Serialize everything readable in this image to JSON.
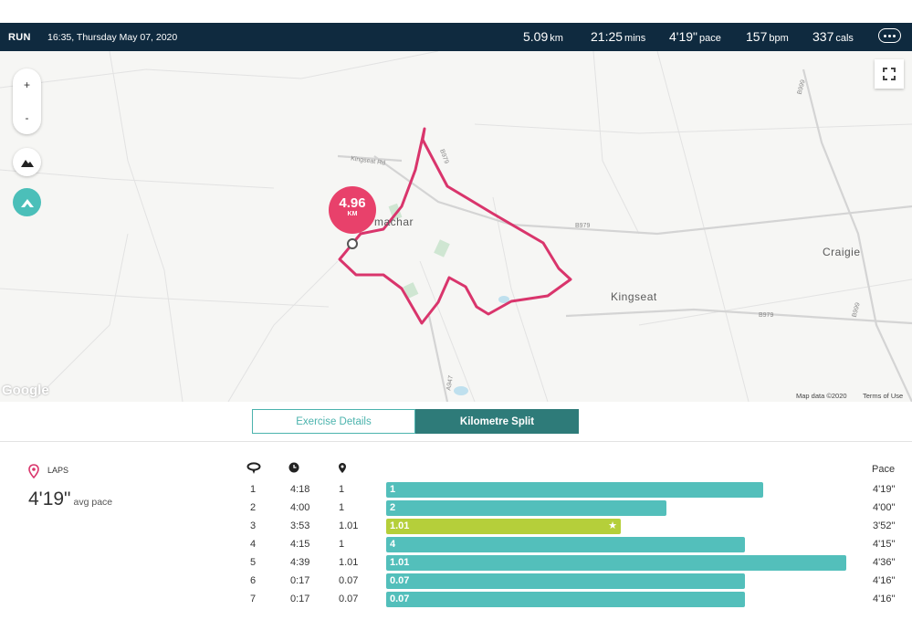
{
  "header": {
    "activity": "RUN",
    "datetime": "16:35, Thursday May 07, 2020",
    "distance": {
      "value": "5.09",
      "unit": "km"
    },
    "duration": {
      "value": "21:25",
      "unit": "mins"
    },
    "pace": {
      "value": "4'19\"",
      "unit": "pace"
    },
    "heart_rate": {
      "value": "157",
      "unit": "bpm"
    },
    "calories": {
      "value": "337",
      "unit": "cals"
    },
    "more_icon": "more-dots-icon"
  },
  "map": {
    "places": [
      "Kingseat",
      "Craigie",
      "machar"
    ],
    "roads": [
      "B979",
      "B979",
      "B979",
      "B999",
      "B999",
      "A947",
      "Kingseat Rd"
    ],
    "pin": {
      "value": "4.96",
      "unit": "KM"
    },
    "zoom_in": "+",
    "zoom_out": "-",
    "google": "Google",
    "map_data": "Map data ©2020",
    "terms": "Terms of Use",
    "route_color": "#d9356c"
  },
  "tabs": [
    {
      "label": "Exercise Details",
      "active": false
    },
    {
      "label": "Kilometre Split",
      "active": true
    }
  ],
  "laps": {
    "label": "LAPS",
    "avg_pace": "4'19\"",
    "avg_unit": "avg pace",
    "pace_header": "Pace",
    "rows": [
      {
        "lap": "1",
        "time": "4:18",
        "dist": "1",
        "bar_label": "1",
        "pace": "4'19\"",
        "fraction": 0.82,
        "color": "#53bfbb",
        "best": false
      },
      {
        "lap": "2",
        "time": "4:00",
        "dist": "1",
        "bar_label": "2",
        "pace": "4'00\"",
        "fraction": 0.61,
        "color": "#53bfbb",
        "best": false
      },
      {
        "lap": "3",
        "time": "3:53",
        "dist": "1.01",
        "bar_label": "1.01",
        "pace": "3'52\"",
        "fraction": 0.51,
        "color": "#b5cf3a",
        "best": true
      },
      {
        "lap": "4",
        "time": "4:15",
        "dist": "1",
        "bar_label": "4",
        "pace": "4'15\"",
        "fraction": 0.78,
        "color": "#53bfbb",
        "best": false
      },
      {
        "lap": "5",
        "time": "4:39",
        "dist": "1.01",
        "bar_label": "1.01",
        "pace": "4'36\"",
        "fraction": 1.0,
        "color": "#53bfbb",
        "best": false
      },
      {
        "lap": "6",
        "time": "0:17",
        "dist": "0.07",
        "bar_label": "0.07",
        "pace": "4'16\"",
        "fraction": 0.78,
        "color": "#53bfbb",
        "best": false
      },
      {
        "lap": "7",
        "time": "0:17",
        "dist": "0.07",
        "bar_label": "0.07",
        "pace": "4'16\"",
        "fraction": 0.78,
        "color": "#53bfbb",
        "best": false
      }
    ]
  }
}
